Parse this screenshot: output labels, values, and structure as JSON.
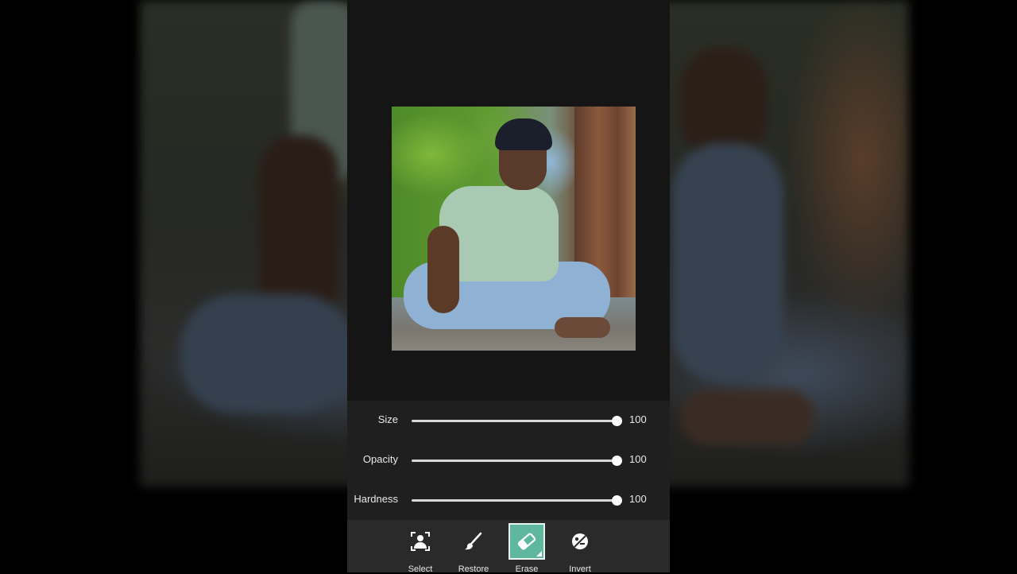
{
  "sliders": [
    {
      "label": "Size",
      "value": "100",
      "fraction": 1.0
    },
    {
      "label": "Opacity",
      "value": "100",
      "fraction": 1.0
    },
    {
      "label": "Hardness",
      "value": "100",
      "fraction": 1.0
    }
  ],
  "tools": [
    {
      "label": "Select",
      "icon": "select-person-icon",
      "active": false
    },
    {
      "label": "Restore",
      "icon": "brush-icon",
      "active": false
    },
    {
      "label": "Erase",
      "icon": "eraser-icon",
      "active": true
    },
    {
      "label": "Invert",
      "icon": "invert-icon",
      "active": false
    }
  ],
  "colors": {
    "accent": "#5fb7a0",
    "panel": "#1f1f1f",
    "toolbar": "#2a2a2a"
  }
}
